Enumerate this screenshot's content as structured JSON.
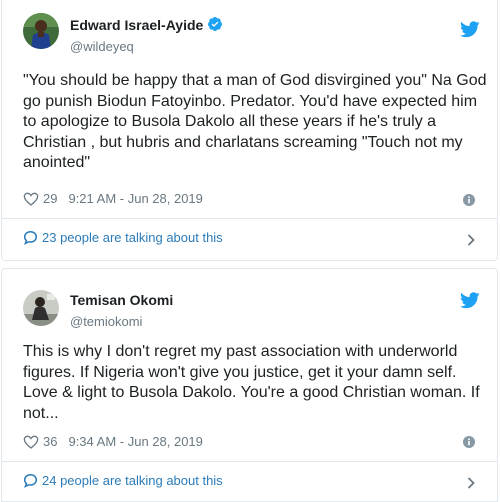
{
  "colors": {
    "link": "#2b7bb9",
    "muted": "#697882",
    "text": "#1c2022",
    "verified": "#1da1f2",
    "twitter": "#1da1f2",
    "border": "#e1e8ed"
  },
  "tweets": [
    {
      "author_name": "Edward Israel-Ayide",
      "verified": true,
      "handle": "@wildeyeq",
      "text": "\"You should be happy that a man of God disvirgined you\" Na God go punish Biodun Fatoyinbo. Predator. You'd have expected him to apologize to Busola Dakolo all these years if he's truly a Christian , but hubris and charlatans screaming \"Touch not my anointed\"",
      "likes": "29",
      "timestamp": "9:21 AM - Jun 28, 2019",
      "talking": "23 people are talking about this",
      "icons": [
        "avatar",
        "verified-badge-icon",
        "twitter-bird-icon",
        "heart-icon",
        "info-icon",
        "speech-bubble-icon",
        "chevron-right-icon"
      ]
    },
    {
      "author_name": "Temisan Okomi",
      "verified": false,
      "handle": "@temiokomi",
      "text": "This is why I don't regret my past association with underworld figures. If Nigeria won't give you justice, get it your damn self. Love & light to Busola Dakolo. You're a good Christian woman. If not...",
      "likes": "36",
      "timestamp": "9:34 AM - Jun 28, 2019",
      "talking": "24 people are talking about this",
      "icons": [
        "avatar",
        "twitter-bird-icon",
        "heart-icon",
        "info-icon",
        "speech-bubble-icon",
        "chevron-right-icon"
      ]
    }
  ]
}
